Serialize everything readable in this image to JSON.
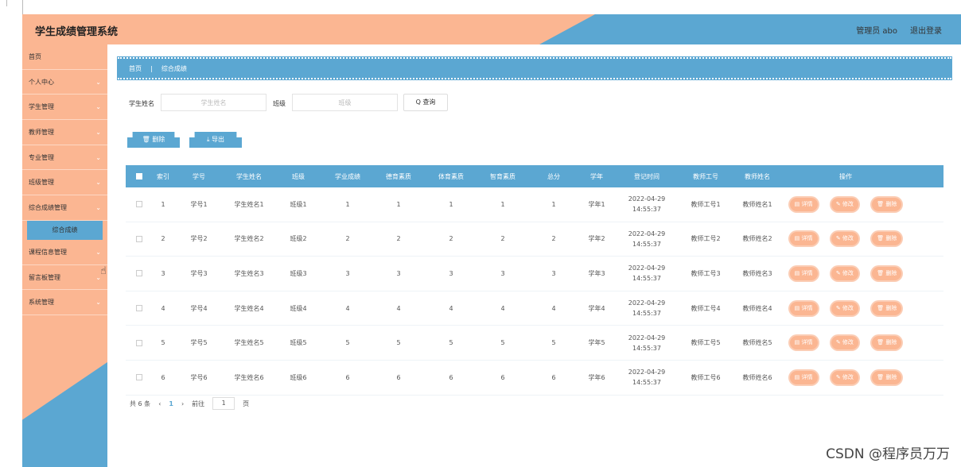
{
  "header": {
    "title": "学生成绩管理系统",
    "user": "管理员 abo",
    "logout": "退出登录"
  },
  "sidebar": {
    "items": [
      {
        "label": "首页",
        "chev": ""
      },
      {
        "label": "个人中心",
        "chev": "⌄"
      },
      {
        "label": "学生管理",
        "chev": "⌄"
      },
      {
        "label": "教师管理",
        "chev": "⌄"
      },
      {
        "label": "专业管理",
        "chev": "⌄"
      },
      {
        "label": "班级管理",
        "chev": "⌄"
      },
      {
        "label": "综合成绩管理",
        "chev": "⌄"
      }
    ],
    "sub": "综合成绩",
    "items2": [
      {
        "label": "课程信息管理",
        "chev": "⌄"
      },
      {
        "label": "留言板管理",
        "chev": "⌄"
      },
      {
        "label": "系统管理",
        "chev": "⌄"
      }
    ]
  },
  "breadcrumb": {
    "home": "首页",
    "sep": "|",
    "current": "综合成绩"
  },
  "search": {
    "name_label": "学生姓名",
    "name_placeholder": "学生姓名",
    "class_label": "班级",
    "class_placeholder": "班级",
    "query": "Q 查询"
  },
  "actions": {
    "delete": "🗑 删除",
    "export": "⤓ 导出"
  },
  "table": {
    "headers": [
      "索引",
      "学号",
      "学生姓名",
      "班级",
      "学业成绩",
      "德育素质",
      "体育素质",
      "智育素质",
      "总分",
      "学年",
      "登记时间",
      "教师工号",
      "教师姓名",
      "操作"
    ],
    "ops": {
      "detail": "▤ 详情",
      "edit": "✎ 修改",
      "delete": "🗑 删除"
    },
    "rows": [
      [
        "1",
        "学号1",
        "学生姓名1",
        "班级1",
        "1",
        "1",
        "1",
        "1",
        "1",
        "学年1",
        "2022-04-29",
        "14:55:37",
        "教师工号1",
        "教师姓名1"
      ],
      [
        "2",
        "学号2",
        "学生姓名2",
        "班级2",
        "2",
        "2",
        "2",
        "2",
        "2",
        "学年2",
        "2022-04-29",
        "14:55:37",
        "教师工号2",
        "教师姓名2"
      ],
      [
        "3",
        "学号3",
        "学生姓名3",
        "班级3",
        "3",
        "3",
        "3",
        "3",
        "3",
        "学年3",
        "2022-04-29",
        "14:55:37",
        "教师工号3",
        "教师姓名3"
      ],
      [
        "4",
        "学号4",
        "学生姓名4",
        "班级4",
        "4",
        "4",
        "4",
        "4",
        "4",
        "学年4",
        "2022-04-29",
        "14:55:37",
        "教师工号4",
        "教师姓名4"
      ],
      [
        "5",
        "学号5",
        "学生姓名5",
        "班级5",
        "5",
        "5",
        "5",
        "5",
        "5",
        "学年5",
        "2022-04-29",
        "14:55:37",
        "教师工号5",
        "教师姓名5"
      ],
      [
        "6",
        "学号6",
        "学生姓名6",
        "班级6",
        "6",
        "6",
        "6",
        "6",
        "6",
        "学年6",
        "2022-04-29",
        "14:55:37",
        "教师工号6",
        "教师姓名6"
      ]
    ]
  },
  "pager": {
    "total": "共 6 条",
    "prev": "‹",
    "page": "1",
    "next": "›",
    "goto": "前往",
    "goto_value": "1",
    "unit": "页"
  },
  "watermark": "CSDN @程序员万万"
}
